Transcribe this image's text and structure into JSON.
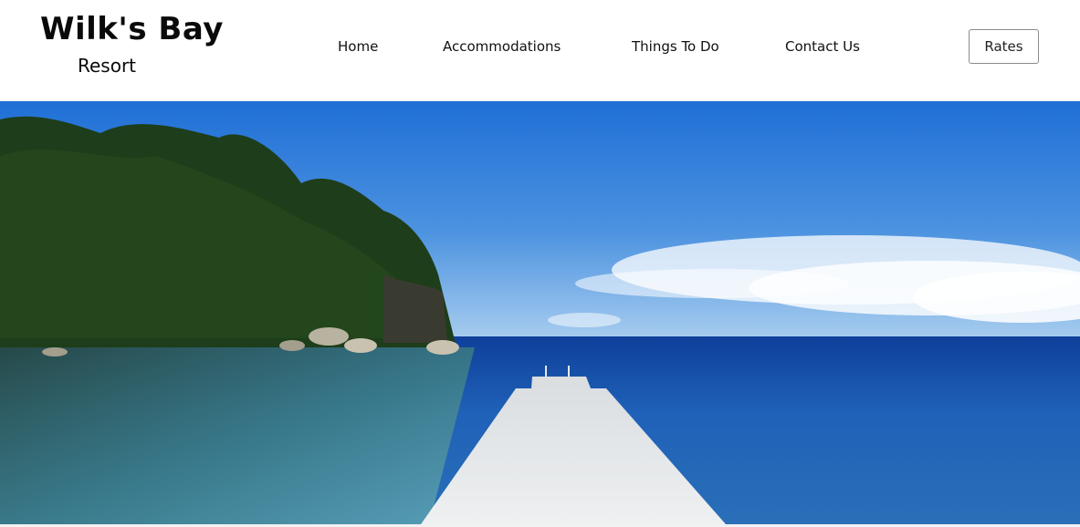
{
  "brand": {
    "title": "Wilk's Bay",
    "subtitle": "Resort"
  },
  "nav": {
    "items": [
      {
        "label": "Home"
      },
      {
        "label": "Accommodations"
      },
      {
        "label": "Things To Do"
      },
      {
        "label": "Contact Us"
      }
    ],
    "rates_label": "Rates"
  },
  "hero": {
    "image_icon": "beach-pier-photo"
  },
  "colors": {
    "sky_top": "#1f6fd6",
    "sky_bottom": "#cfe3f5",
    "sea": "#1c4f9e",
    "foliage": "#1e3d1a"
  }
}
